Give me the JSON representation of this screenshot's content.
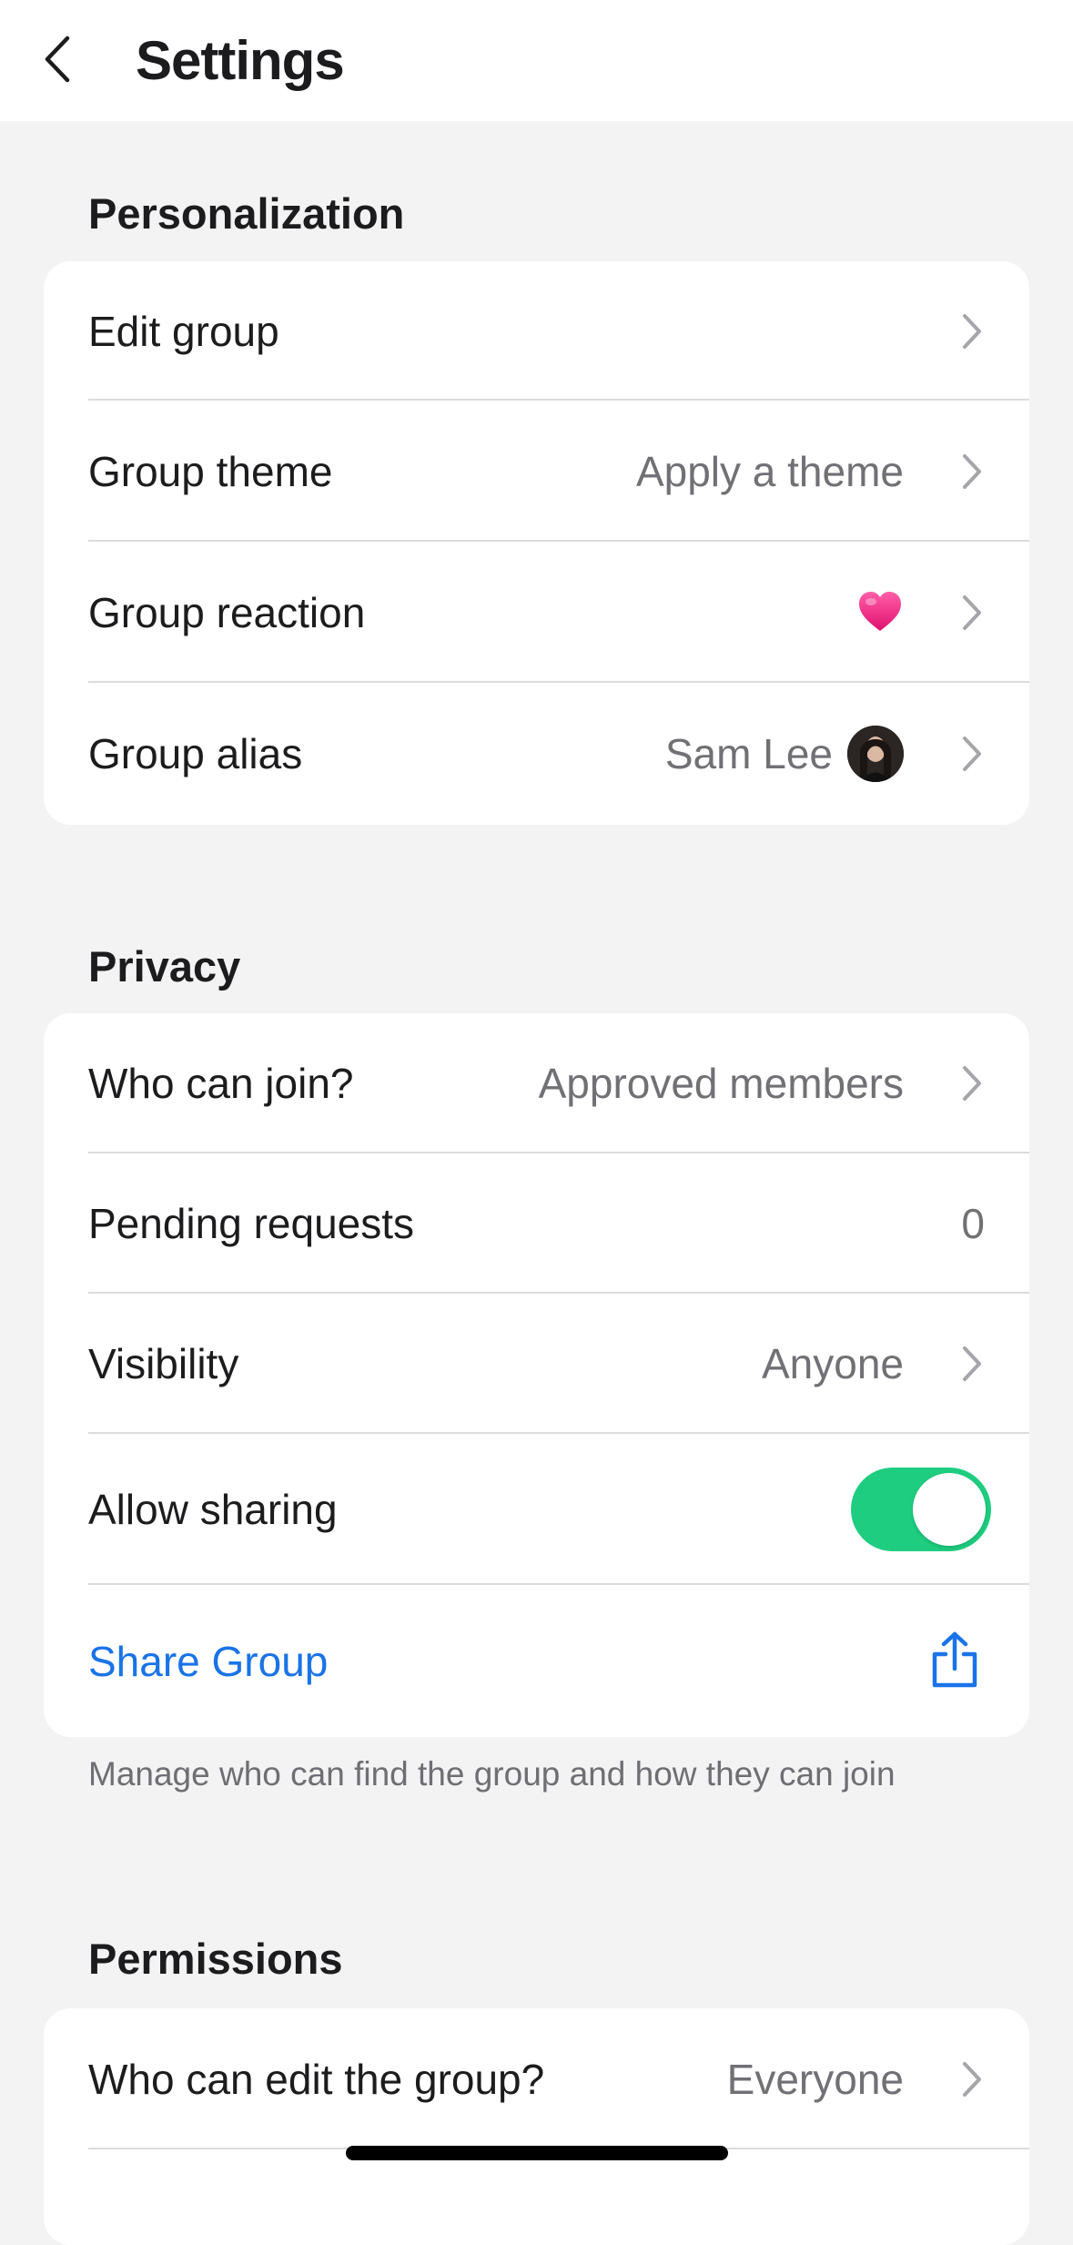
{
  "header": {
    "title": "Settings"
  },
  "personalization": {
    "title": "Personalization",
    "rows": [
      {
        "label": "Edit group",
        "value": ""
      },
      {
        "label": "Group theme",
        "value": "Apply a theme"
      },
      {
        "label": "Group reaction",
        "value_icon": "heart-emoji"
      },
      {
        "label": "Group alias",
        "value": "Sam Lee",
        "value_icon": "user-avatar"
      }
    ]
  },
  "privacy": {
    "title": "Privacy",
    "rows": [
      {
        "label": "Who can join?",
        "value": "Approved members"
      },
      {
        "label": "Pending requests",
        "value": "0"
      },
      {
        "label": "Visibility",
        "value": "Anyone"
      },
      {
        "label": "Allow sharing",
        "toggle_on": true
      },
      {
        "label": "Share Group",
        "icon": "share-icon"
      }
    ],
    "footnote": "Manage who can find the group and how they can join"
  },
  "permissions": {
    "title": "Permissions",
    "rows": [
      {
        "label": "Who can edit the group?",
        "value": "Everyone"
      }
    ]
  },
  "colors": {
    "background": "#f3f3f3",
    "card": "#ffffff",
    "toggle_on": "#1ecd80",
    "link": "#1a73e8",
    "secondary_text": "#707075"
  }
}
